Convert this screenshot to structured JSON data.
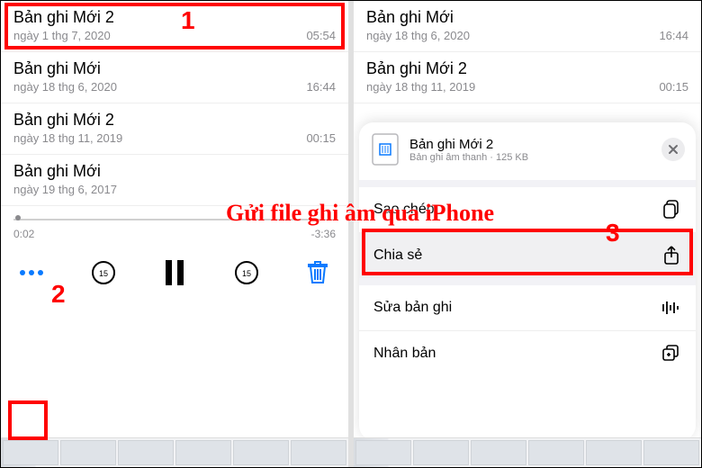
{
  "overlay_title": "Gửi file ghi âm qua iPhone",
  "steps": {
    "one": "1",
    "two": "2",
    "three": "3"
  },
  "left": {
    "recordings": [
      {
        "title": "Bản ghi Mới 2",
        "date": "ngày 1 thg 7, 2020",
        "dur": "05:54"
      },
      {
        "title": "Bản ghi Mới",
        "date": "ngày 18 thg 6, 2020",
        "dur": "16:44"
      },
      {
        "title": "Bản ghi Mới 2",
        "date": "ngày 18 thg 11, 2019",
        "dur": "00:15"
      },
      {
        "title": "Bản ghi Mới",
        "date": "ngày 19 thg 6, 2017",
        "dur": ""
      }
    ],
    "player": {
      "elapsed": "0:02",
      "remaining": "-3:36"
    }
  },
  "right": {
    "recordings": [
      {
        "title": "Bản ghi Mới",
        "date": "ngày 18 thg 6, 2020",
        "dur": "16:44"
      },
      {
        "title": "Bản ghi Mới 2",
        "date": "ngày 18 thg 11, 2019",
        "dur": "00:15"
      }
    ],
    "sheet": {
      "title": "Bản ghi Mới 2",
      "sub": "Bản ghi âm thanh · 125 KB",
      "items": {
        "copy": "Sao chép",
        "share": "Chia sẻ",
        "edit": "Sửa bản ghi",
        "duplicate": "Nhân bản"
      }
    }
  }
}
